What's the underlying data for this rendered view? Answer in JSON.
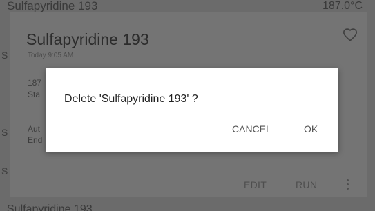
{
  "background": {
    "top_item_title": "Sulfapyridine 193",
    "top_item_value": "187.0°C",
    "bottom_item_title": "Sulfapyridine 193"
  },
  "card": {
    "title": "Sulfapyridine 193",
    "time": "Today 9:05 AM",
    "line1": "187",
    "line2": "Sta",
    "line3": "Aut",
    "line4": "End",
    "edit_label": "EDIT",
    "run_label": "RUN"
  },
  "dialog": {
    "message": "Delete 'Sulfapyridine 193' ?",
    "cancel_label": "CANCEL",
    "ok_label": "OK"
  },
  "icons": {
    "favorite": "heart-outline-icon",
    "overflow": "more-vert-icon"
  }
}
